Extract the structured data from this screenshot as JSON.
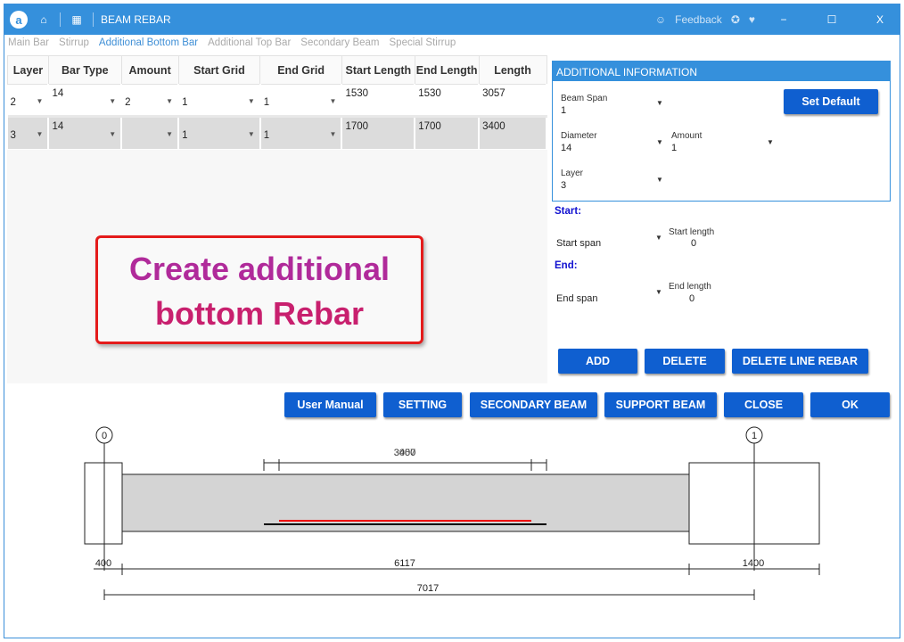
{
  "window": {
    "title": "BEAM REBAR",
    "feedback": "Feedback",
    "minimize": "−",
    "maximize": "☐",
    "close": "X"
  },
  "tabs": [
    "Main Bar",
    "Stirrup",
    "Additional Bottom Bar",
    "Additional Top Bar",
    "Secondary Beam",
    "Special Stirrup"
  ],
  "table": {
    "headers": [
      "Layer",
      "Bar Type",
      "Amount",
      "Start Grid",
      "End Grid",
      "Start Length",
      "End Length",
      "Length"
    ],
    "rows": [
      [
        "2",
        "14",
        "2",
        "1",
        "1",
        "1530",
        "1530",
        "3057"
      ],
      [
        "3",
        "14",
        "",
        "1",
        "1",
        "1700",
        "1700",
        "3400"
      ]
    ]
  },
  "callout": {
    "line1": "Create additional",
    "line2": "bottom Rebar"
  },
  "info": {
    "header": "ADDITIONAL INFORMATION",
    "beam_span_label": "Beam Span",
    "beam_span": "1",
    "set_default": "Set Default",
    "diameter_label": "Diameter",
    "diameter": "14",
    "amount_label": "Amount",
    "amount": "1",
    "layer_label": "Layer",
    "layer": "3"
  },
  "start": {
    "heading": "Start:",
    "span_label": "Start span",
    "length_label": "Start length",
    "length": "0"
  },
  "end": {
    "heading": "End:",
    "span_label": "End span",
    "length_label": "End length",
    "length": "0"
  },
  "buttons": {
    "add": "ADD",
    "delete": "DELETE",
    "delete_line": "DELETE LINE REBAR",
    "manual": "User Manual",
    "setting": "SETTING",
    "secondary": "SECONDARY BEAM",
    "support": "SUPPORT BEAM",
    "close": "CLOSE",
    "ok": "OK"
  },
  "drawing": {
    "grid0": "0",
    "grid1": "1",
    "top_dim_a": "3057",
    "top_dim_b": "3400",
    "dim_left": "400",
    "dim_mid": "6117",
    "dim_right": "1400",
    "dim_total": "7017"
  }
}
